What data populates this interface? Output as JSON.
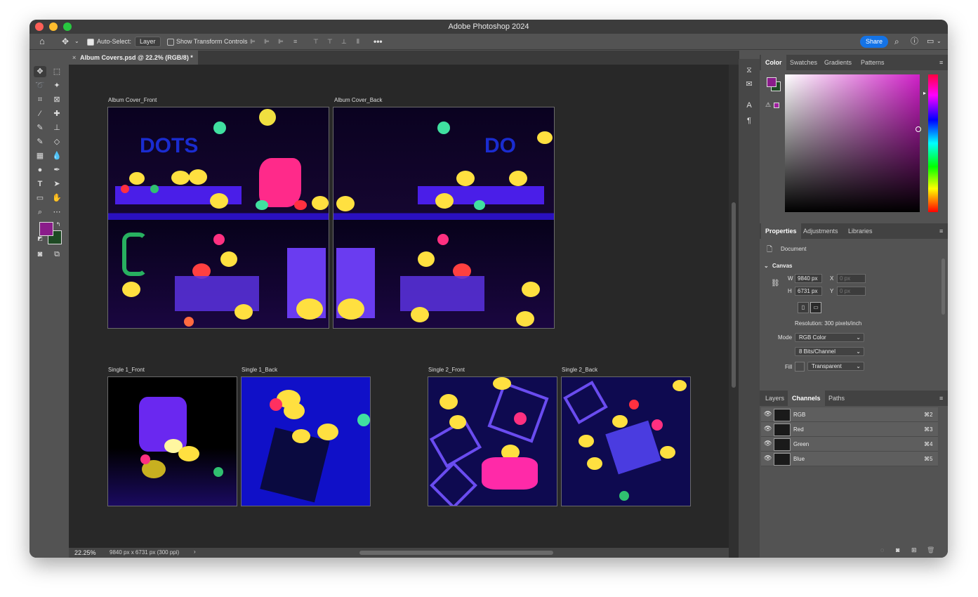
{
  "app": {
    "title": "Adobe Photoshop 2024"
  },
  "options": {
    "auto_select_label": "Auto-Select:",
    "auto_select_value": "Layer",
    "transform_label": "Show Transform Controls",
    "share_label": "Share"
  },
  "document": {
    "tab_title": "Album Covers.psd @ 22.2% (RGB/8) *"
  },
  "artboards": [
    {
      "label": "Album Cover_Front"
    },
    {
      "label": "Album Cover_Back"
    },
    {
      "label": "Single 1_Front"
    },
    {
      "label": "Single 1_Back"
    },
    {
      "label": "Single 2_Front"
    },
    {
      "label": "Single 2_Back"
    }
  ],
  "status": {
    "zoom": "22.25%",
    "info": "9840 px x 6731 px (300 ppi)"
  },
  "color_panel": {
    "tabs": [
      "Color",
      "Swatches",
      "Gradients",
      "Patterns"
    ],
    "foreground": "#8a1c8a",
    "background": "#1e4a24"
  },
  "properties_panel": {
    "tabs": [
      "Properties",
      "Adjustments",
      "Libraries"
    ],
    "doc_label": "Document",
    "section": "Canvas",
    "w_label": "W",
    "w_value": "9840 px",
    "h_label": "H",
    "h_value": "6731 px",
    "x_label": "X",
    "x_placeholder": "0 px",
    "y_label": "Y",
    "y_placeholder": "0 px",
    "resolution": "Resolution: 300 pixels/inch",
    "mode_label": "Mode",
    "mode_value": "RGB Color",
    "depth_value": "8 Bits/Channel",
    "fill_label": "Fill",
    "fill_value": "Transparent"
  },
  "channels_panel": {
    "tabs": [
      "Layers",
      "Channels",
      "Paths"
    ],
    "rows": [
      {
        "name": "RGB",
        "shortcut": "⌘2"
      },
      {
        "name": "Red",
        "shortcut": "⌘3"
      },
      {
        "name": "Green",
        "shortcut": "⌘4"
      },
      {
        "name": "Blue",
        "shortcut": "⌘5"
      }
    ]
  }
}
